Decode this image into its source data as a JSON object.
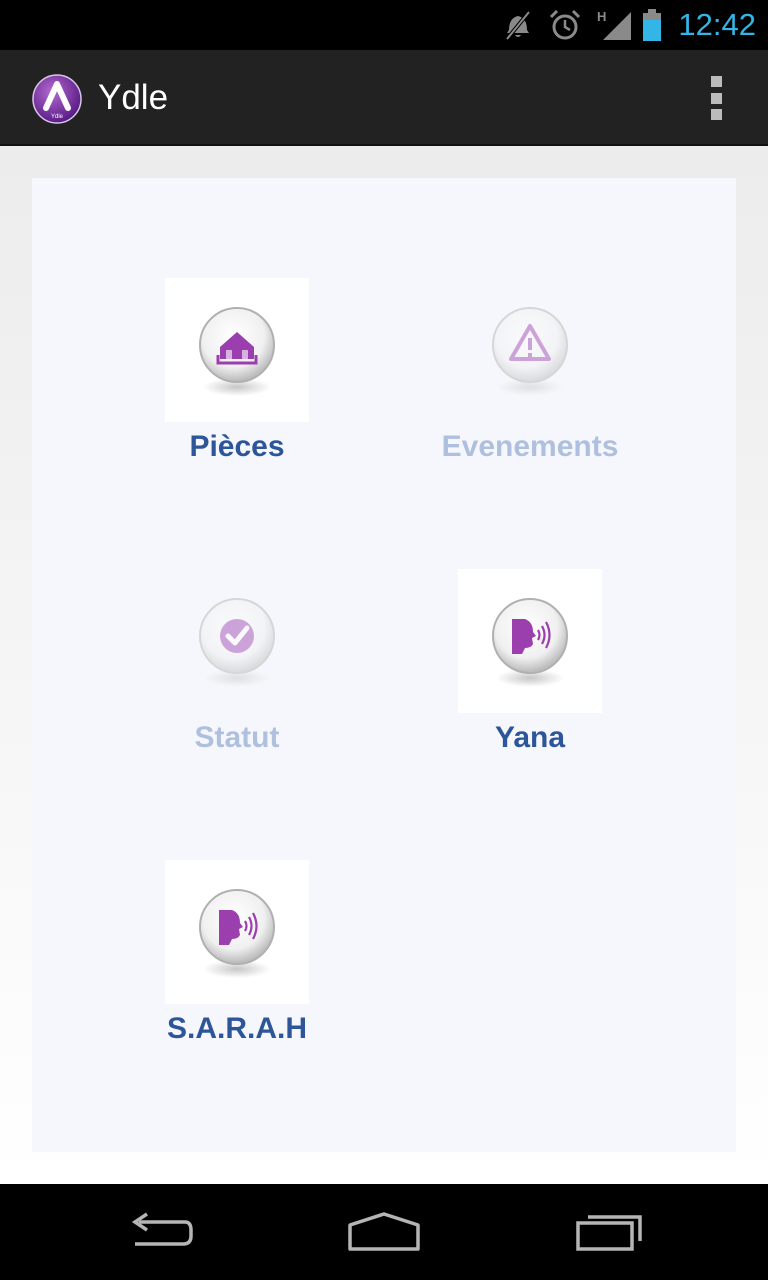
{
  "status_bar": {
    "time": "12:42",
    "network_type": "H",
    "icons": [
      "mute-icon",
      "alarm-icon",
      "signal-icon",
      "battery-icon"
    ],
    "time_color": "#33b5e5"
  },
  "action_bar": {
    "title": "Ydle",
    "logo_text": "Ydle",
    "logo_icon": "ydle-logo-icon",
    "overflow_icon": "overflow-menu-icon"
  },
  "menu": {
    "items": [
      {
        "label": "Pièces",
        "icon": "house-icon",
        "enabled": true
      },
      {
        "label": "Evenements",
        "icon": "warning-icon",
        "enabled": false
      },
      {
        "label": "Statut",
        "icon": "checkmark-icon",
        "enabled": false
      },
      {
        "label": "Yana",
        "icon": "speaking-head-icon",
        "enabled": true
      },
      {
        "label": "S.A.R.A.H",
        "icon": "speaking-head-icon",
        "enabled": true
      }
    ],
    "label_color": "#2d5599",
    "disabled_label_color": "#aec0de",
    "icon_color": "#9b3fae"
  },
  "nav_bar": {
    "buttons": [
      "back-icon",
      "home-icon",
      "recent-apps-icon"
    ]
  }
}
